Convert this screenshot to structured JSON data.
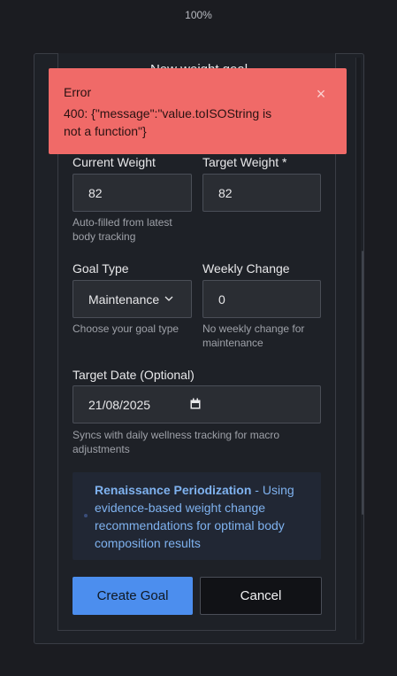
{
  "zoom": "100%",
  "modal": {
    "title": "New weight goal"
  },
  "toast": {
    "title": "Error",
    "message": "400: {\"message\":\"value.toISOString is not a function\"}",
    "close_icon": "×"
  },
  "form": {
    "current_weight": {
      "label": "Current Weight",
      "value": "82",
      "help": "Auto-filled from latest body tracking"
    },
    "target_weight": {
      "label": "Target Weight *",
      "value": "82"
    },
    "goal_type": {
      "label": "Goal Type",
      "value": "Maintenance",
      "help": "Choose your goal type"
    },
    "weekly_change": {
      "label": "Weekly Change",
      "value": "0",
      "help": "No weekly change for maintenance"
    },
    "target_date": {
      "label": "Target Date (Optional)",
      "value": "21/08/2025",
      "help": "Syncs with daily wellness tracking for macro adjustments"
    }
  },
  "info": {
    "title": "Renaissance Periodization",
    "text": " - Using evidence-based weight change recommendations for optimal body composition results"
  },
  "buttons": {
    "create": "Create Goal",
    "cancel": "Cancel"
  },
  "colors": {
    "error_bg": "#f06a68",
    "primary": "#4c8eee",
    "info_text": "#7fb2ef"
  }
}
